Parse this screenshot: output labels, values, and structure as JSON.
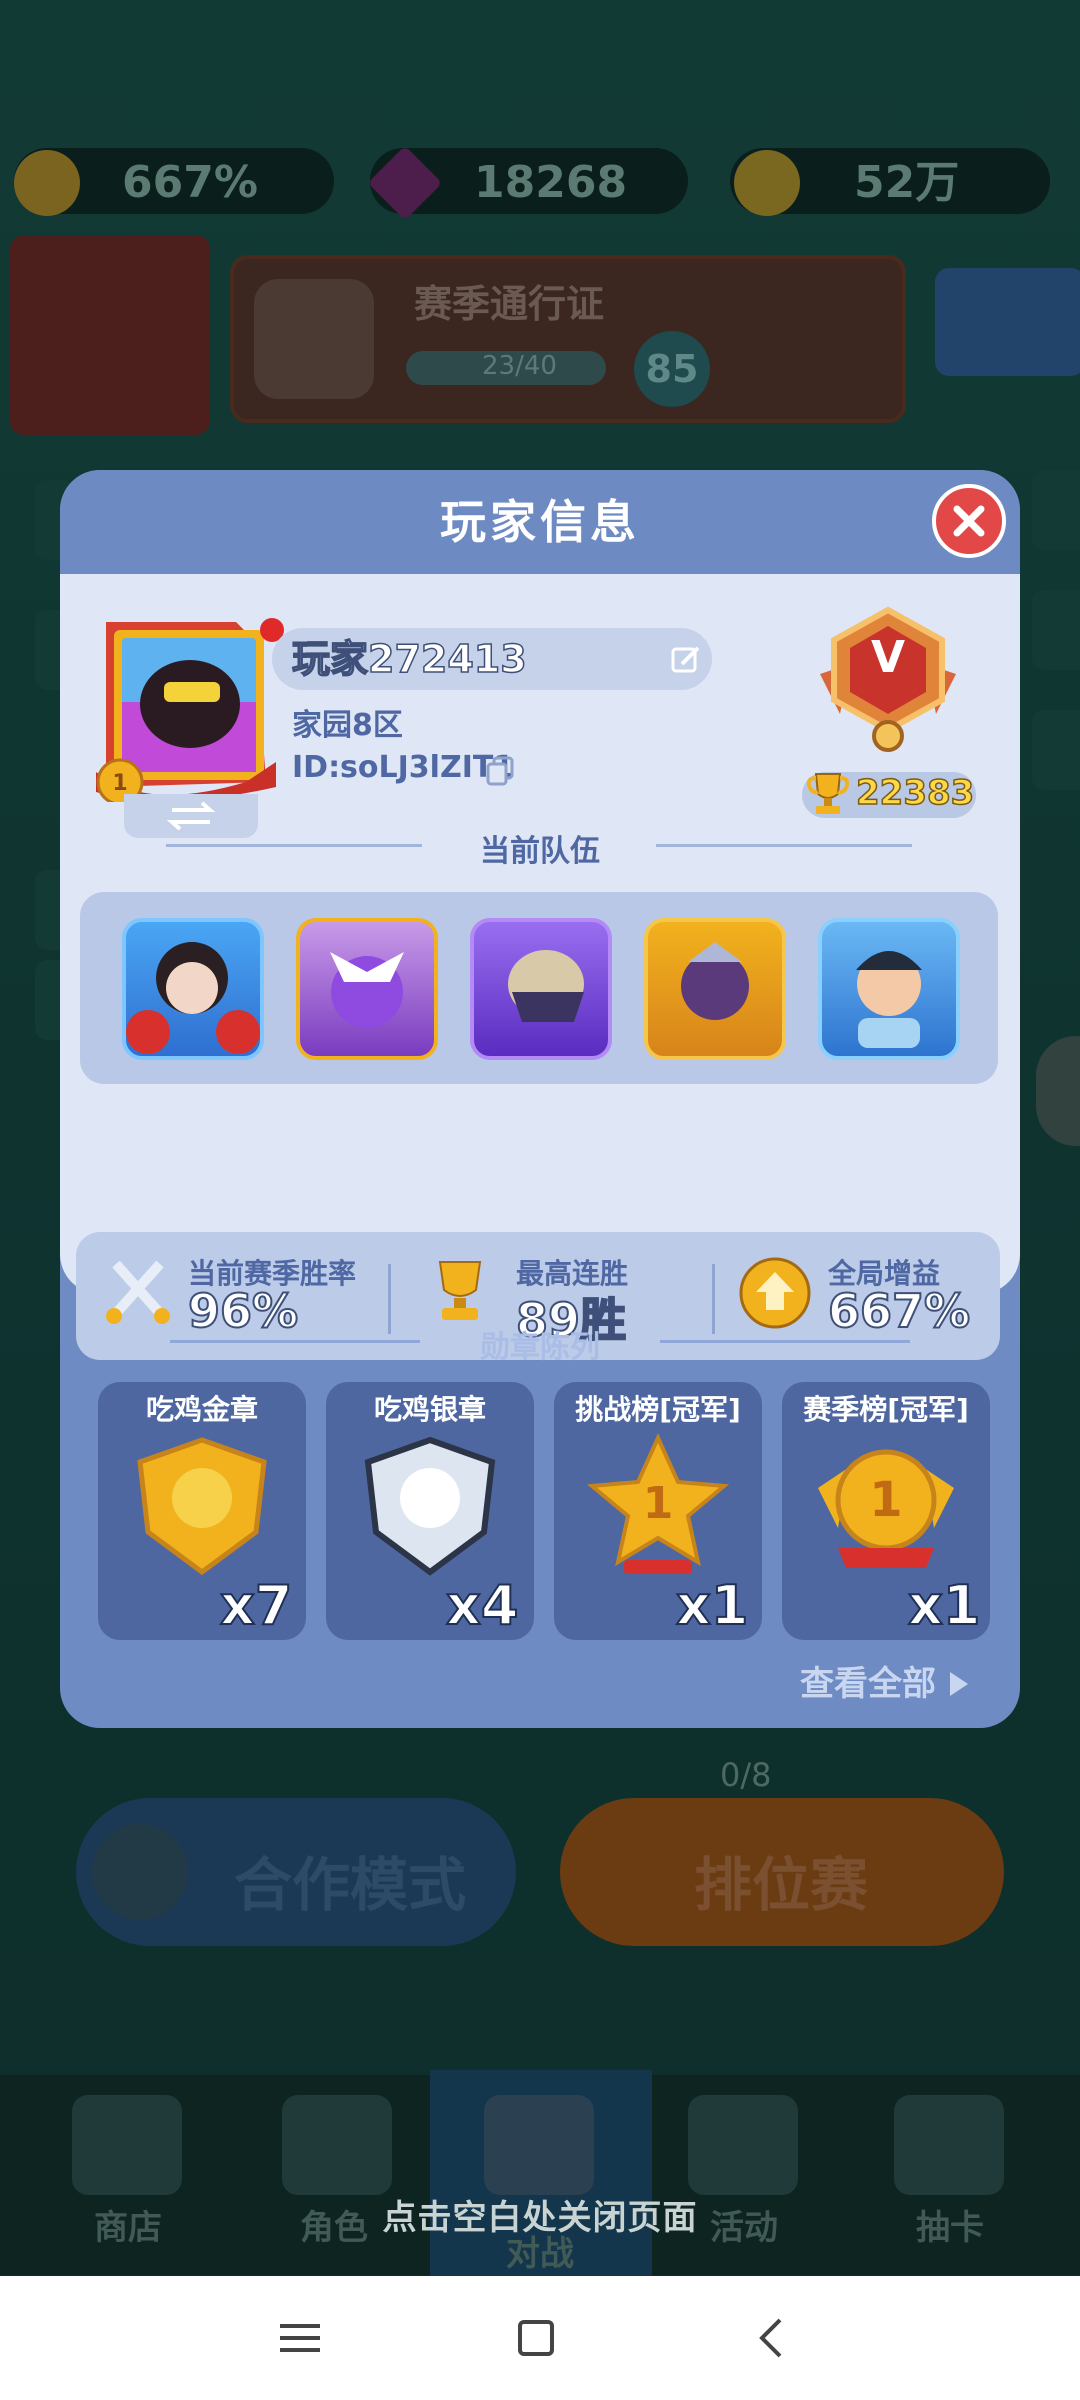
{
  "top_bar": {
    "boost_value": "667%",
    "gems": "18268",
    "coins": "52万"
  },
  "season_pass": {
    "title": "赛季通行证",
    "progress": "23/40",
    "level": "85"
  },
  "modal": {
    "title": "玩家信息",
    "player": {
      "name": "玩家272413",
      "zone": "家园8区",
      "id": "ID:soLJ3lZIT1",
      "rank_letter": "V",
      "trophies": "22383"
    },
    "team": {
      "title": "当前队伍",
      "heroes": [
        "hero-girl-red-pompoms",
        "hero-purple-dragon",
        "hero-armored-knight",
        "hero-dark-elf",
        "hero-pilot"
      ]
    },
    "stats": {
      "win_rate_label": "当前赛季胜率",
      "win_rate": "96%",
      "streak_label": "最高连胜",
      "streak": "89胜",
      "boost_label": "全局增益",
      "boost": "667%"
    },
    "medals": {
      "title": "勋章陈列",
      "items": [
        {
          "label": "吃鸡金章",
          "count": "x7"
        },
        {
          "label": "吃鸡银章",
          "count": "x4"
        },
        {
          "label": "挑战榜[冠军]",
          "count": "x1"
        },
        {
          "label": "赛季榜[冠军]",
          "count": "x1"
        }
      ],
      "view_all": "查看全部"
    }
  },
  "background": {
    "queue": "0/8",
    "coop_mode": "合作模式",
    "ranked_mode": "排位赛",
    "nav": [
      "商店",
      "角色",
      "对战",
      "活动",
      "抽卡"
    ]
  },
  "close_hint": "点击空白处关闭页面",
  "colors": {
    "modal_blue": "#6e8bc3",
    "panel_light": "#dfe6f5",
    "close_red": "#e34848",
    "gold": "#ffd84a"
  }
}
